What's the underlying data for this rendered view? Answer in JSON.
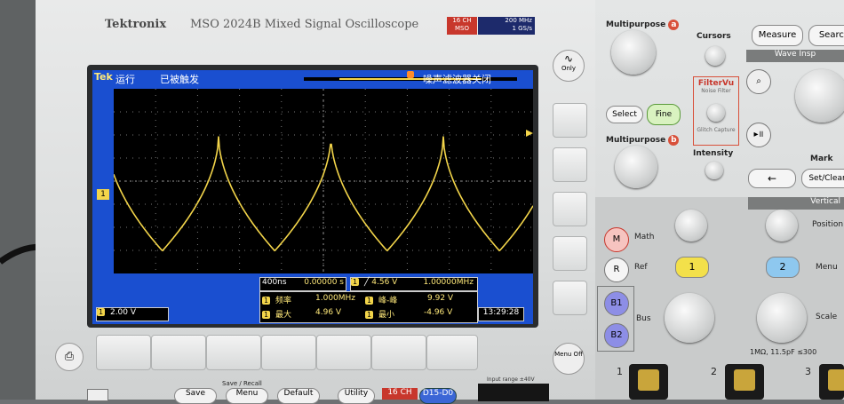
{
  "header": {
    "brand": "Tektronix",
    "model": "MSO 2024B Mixed Signal Oscilloscope",
    "badge_line1": "16 CH",
    "badge_line2": "MSO",
    "spec_line1": "200 MHz",
    "spec_line2": "1 GS/s"
  },
  "screen": {
    "logo": "Tek",
    "run_state": "运行",
    "trig_state": "已被触发",
    "noise_filter": "噪声滤波器关闭",
    "ch1_marker": "1"
  },
  "measurements": {
    "timebase": "400ns",
    "trig_pos": "0.00000 s",
    "trig_level": "4.56 V",
    "freq_readout": "1.00000MHz",
    "freq_label": "频率",
    "freq_value": "1.000MHz",
    "pkpk_label": "峰-峰",
    "pkpk_value": "9.92 V",
    "max_label": "最大",
    "max_value": "4.96 V",
    "min_label": "最小",
    "min_value": "-4.96 V",
    "ch_scale": "2.00 V",
    "time": "13:29:28",
    "ch_num": "1"
  },
  "bezel": {
    "only_label": "Only",
    "menu_off_label": "Menu Off",
    "save_recall": "Save / Recall",
    "save": "Save",
    "menu": "Menu",
    "default": "Default",
    "utility": "Utility",
    "ch16": "16 CH",
    "d15d0": "D15-D0",
    "input_range": "Input range ±40V"
  },
  "controls": {
    "multipurpose_a": "Multipurpose",
    "a": "a",
    "multipurpose_b": "Multipurpose",
    "b": "b",
    "select": "Select",
    "fine": "Fine",
    "cursors": "Cursors",
    "filtervu": "FilterVu",
    "noise_filter": "Noise Filter",
    "glitch_capture": "Glitch Capture",
    "intensity": "Intensity",
    "measure": "Measure",
    "search": "Search",
    "wave_inspector": "Wave Insp",
    "mark": "Mark",
    "set_clear": "Set/Clear",
    "vertical": "Vertical",
    "m": "M",
    "math": "Math",
    "r": "R",
    "ref": "Ref",
    "ch1": "1",
    "ch2": "2",
    "menu": "Menu",
    "position": "Position",
    "b1": "B1",
    "b2": "B2",
    "bus": "Bus",
    "scale": "Scale",
    "impedance": "1MΩ, 11.5pF ≤300",
    "in1": "1",
    "in2": "2",
    "in3": "3"
  },
  "colors": {
    "screen_blue": "#1a4fd0",
    "trace_yellow": "#f3d54a",
    "accent_red": "#c8372c",
    "fine_green": "#d9f2c0",
    "bus_purple": "#8d8ee6"
  },
  "chart_data": {
    "type": "line",
    "series": [
      {
        "values": [
          4.96,
          -4.96,
          4.96,
          -4.96,
          4.96,
          -4.96,
          4.96
        ]
      }
    ],
    "xlabel": "",
    "ylabel": "",
    "grid": true
  }
}
